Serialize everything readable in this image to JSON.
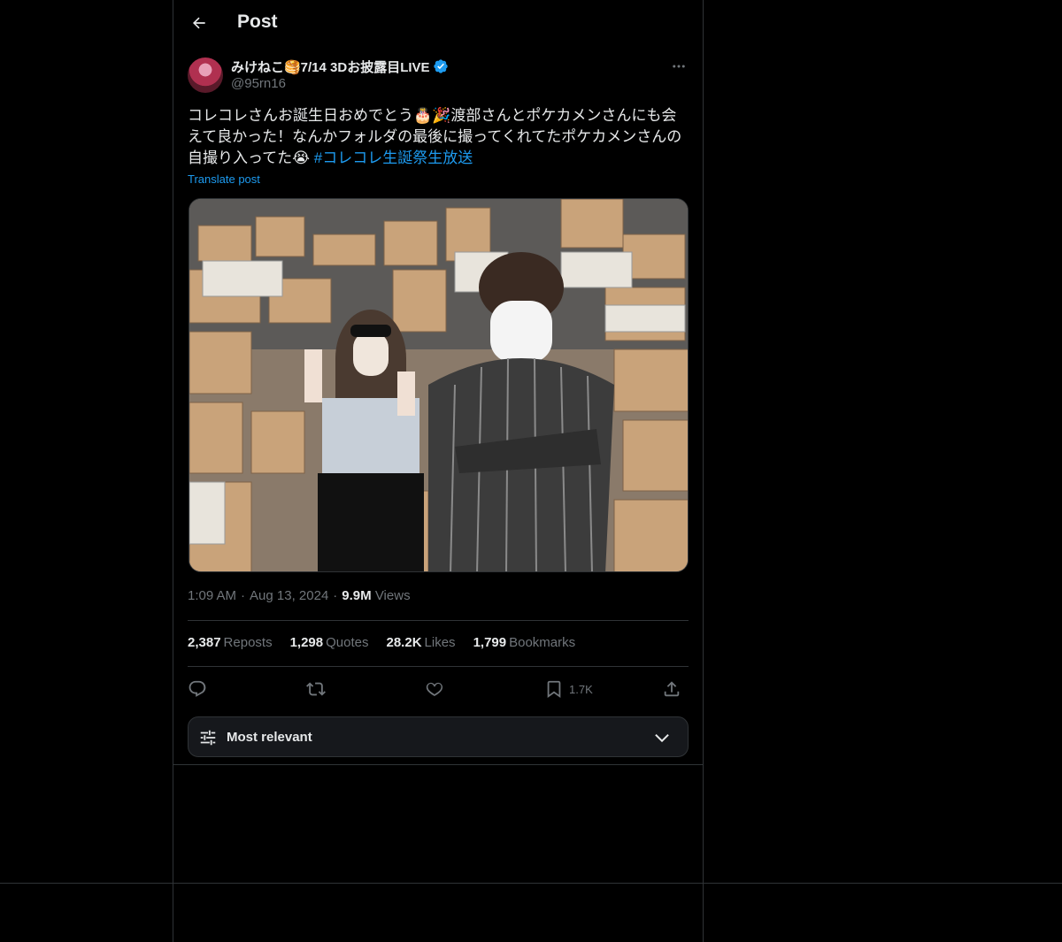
{
  "header": {
    "title": "Post"
  },
  "post": {
    "author_name": "みけねこ🥞7/14 3Dお披露目LIVE",
    "handle": "@95rn16",
    "text_line": "コレコレさんお誕生日おめでとう🎂🎉渡部さんとポケカメンさんにも会えて良かった！なんかフォルダの最後に撮ってくれてたポケカメンさんの自撮り入ってた😭",
    "hashtag": "#コレコレ生誕祭生放送",
    "translate_label": "Translate post",
    "time": "1:09 AM",
    "dot1": "·",
    "date": "Aug 13, 2024",
    "dot2": "·",
    "views_count": "9.9M",
    "views_label": "Views"
  },
  "stats": {
    "reposts_count": "2,387",
    "reposts_label": "Reposts",
    "quotes_count": "1,298",
    "quotes_label": "Quotes",
    "likes_count": "28.2K",
    "likes_label": "Likes",
    "bookmarks_count": "1,799",
    "bookmarks_label": "Bookmarks"
  },
  "actions": {
    "bookmark_count": "1.7K"
  },
  "sort": {
    "label": "Most relevant"
  },
  "colors": {
    "accent": "#1d9bf0",
    "background": "#000000",
    "border": "#2f3336",
    "muted": "#71767b"
  }
}
